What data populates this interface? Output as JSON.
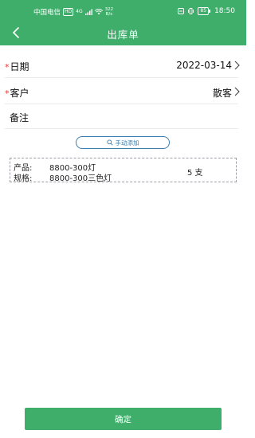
{
  "status_bar": {
    "carrier": "中国电信",
    "hd": "HD",
    "network": "4G",
    "speed_value": "322",
    "speed_unit": "B/s",
    "battery": "85",
    "time": "18:50"
  },
  "header": {
    "title": "出库单"
  },
  "form": {
    "date_label": "日期",
    "date_value": "2022-03-14",
    "customer_label": "客户",
    "customer_value": "散客",
    "remark_label": "备注",
    "required_mark": "*"
  },
  "add_button": {
    "label": "手动添加"
  },
  "product": {
    "product_key": "产品:",
    "product_name": "8800-300灯",
    "spec_key": "规格:",
    "spec_value": "8800-300三色灯",
    "quantity": "5 支"
  },
  "footer": {
    "confirm_label": "确定"
  },
  "colors": {
    "primary": "#3fae6b",
    "required": "#e03a3a",
    "outline_blue": "#3c7fb0"
  }
}
